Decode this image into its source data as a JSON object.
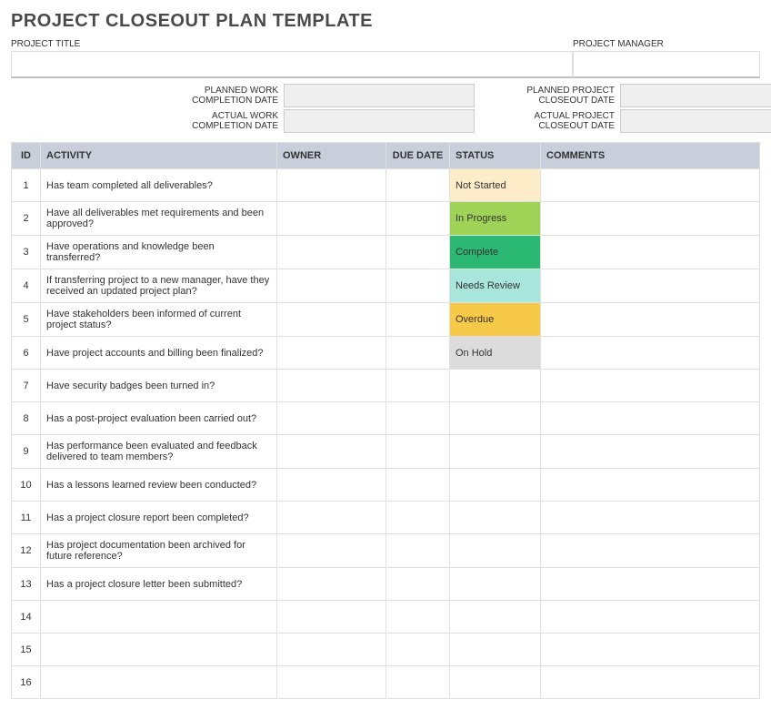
{
  "title": "PROJECT CLOSEOUT PLAN TEMPLATE",
  "meta": {
    "project_title_label": "PROJECT TITLE",
    "project_title_value": "",
    "project_manager_label": "PROJECT MANAGER",
    "project_manager_value": ""
  },
  "dates": {
    "planned_work_label": "PLANNED WORK COMPLETION DATE",
    "planned_work_value": "",
    "actual_work_label": "ACTUAL WORK COMPLETION DATE",
    "actual_work_value": "",
    "planned_closeout_label": "PLANNED PROJECT CLOSEOUT DATE",
    "planned_closeout_value": "",
    "actual_closeout_label": "ACTUAL PROJECT CLOSEOUT DATE",
    "actual_closeout_value": ""
  },
  "columns": {
    "id": "ID",
    "activity": "ACTIVITY",
    "owner": "OWNER",
    "due": "DUE DATE",
    "status": "STATUS",
    "comments": "COMMENTS"
  },
  "status_colors": {
    "Not Started": "status-not-started",
    "In Progress": "status-in-progress",
    "Complete": "status-complete",
    "Needs Review": "status-needs-review",
    "Overdue": "status-overdue",
    "On Hold": "status-on-hold"
  },
  "rows": [
    {
      "id": "1",
      "activity": "Has team completed all deliverables?",
      "owner": "",
      "due": "",
      "status": "Not Started",
      "comments": ""
    },
    {
      "id": "2",
      "activity": "Have all deliverables met requirements and been approved?",
      "owner": "",
      "due": "",
      "status": "In Progress",
      "comments": ""
    },
    {
      "id": "3",
      "activity": "Have operations and knowledge been transferred?",
      "owner": "",
      "due": "",
      "status": "Complete",
      "comments": ""
    },
    {
      "id": "4",
      "activity": "If transferring project to a new manager, have they received an updated project plan?",
      "owner": "",
      "due": "",
      "status": "Needs Review",
      "comments": ""
    },
    {
      "id": "5",
      "activity": "Have stakeholders been informed of current project status?",
      "owner": "",
      "due": "",
      "status": "Overdue",
      "comments": ""
    },
    {
      "id": "6",
      "activity": "Have project accounts and billing been finalized?",
      "owner": "",
      "due": "",
      "status": "On Hold",
      "comments": ""
    },
    {
      "id": "7",
      "activity": "Have security badges been turned in?",
      "owner": "",
      "due": "",
      "status": "",
      "comments": ""
    },
    {
      "id": "8",
      "activity": "Has a post-project evaluation been carried out?",
      "owner": "",
      "due": "",
      "status": "",
      "comments": ""
    },
    {
      "id": "9",
      "activity": "Has performance been evaluated and feedback delivered to team members?",
      "owner": "",
      "due": "",
      "status": "",
      "comments": ""
    },
    {
      "id": "10",
      "activity": "Has a lessons learned review been conducted?",
      "owner": "",
      "due": "",
      "status": "",
      "comments": ""
    },
    {
      "id": "11",
      "activity": "Has a project closure report been completed?",
      "owner": "",
      "due": "",
      "status": "",
      "comments": ""
    },
    {
      "id": "12",
      "activity": "Has project documentation been archived for future reference?",
      "owner": "",
      "due": "",
      "status": "",
      "comments": ""
    },
    {
      "id": "13",
      "activity": "Has a project closure letter been submitted?",
      "owner": "",
      "due": "",
      "status": "",
      "comments": ""
    },
    {
      "id": "14",
      "activity": "",
      "owner": "",
      "due": "",
      "status": "",
      "comments": ""
    },
    {
      "id": "15",
      "activity": "",
      "owner": "",
      "due": "",
      "status": "",
      "comments": ""
    },
    {
      "id": "16",
      "activity": "",
      "owner": "",
      "due": "",
      "status": "",
      "comments": ""
    }
  ]
}
